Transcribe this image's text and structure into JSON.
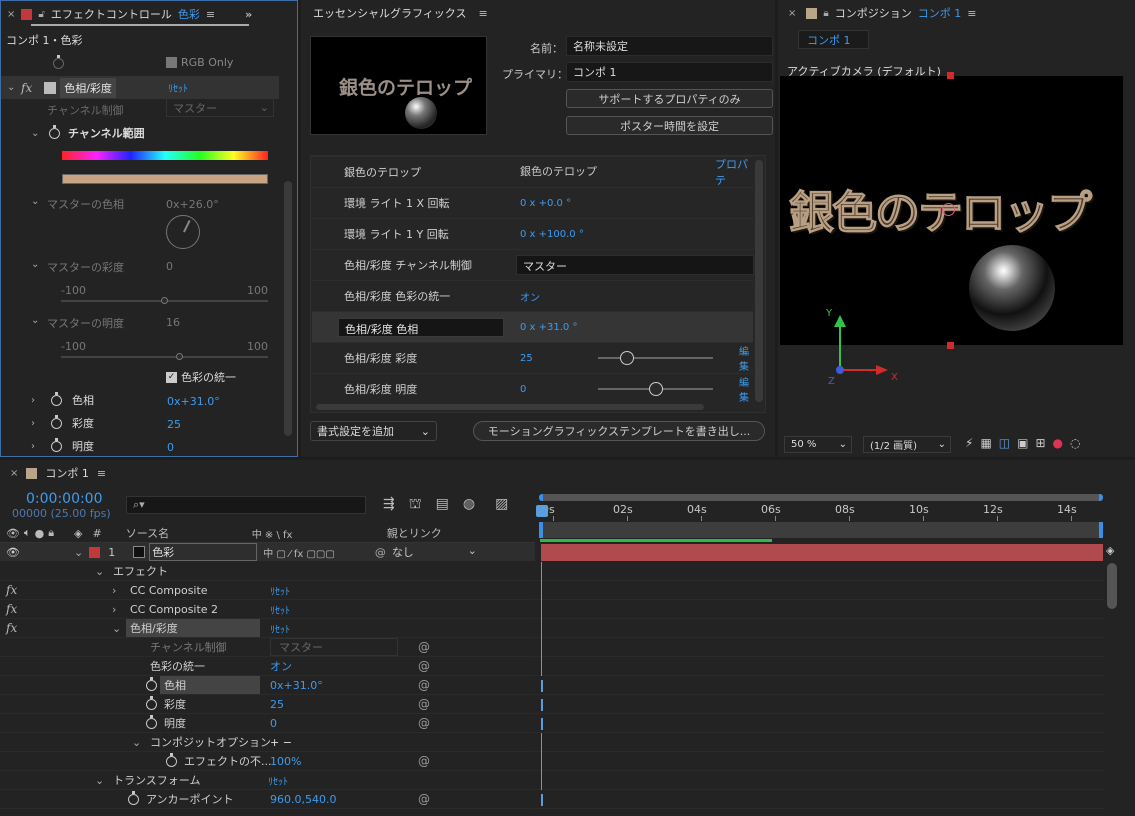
{
  "effect_controls": {
    "title": "エフェクトコントロール",
    "layer": "色彩",
    "breadcrumb": "コンポ 1・色彩",
    "rgb_only": "RGB Only",
    "effect_name": "色相/彩度",
    "reset": "ﾘｾｯﾄ",
    "channel_control_label": "チャンネル制御",
    "channel_control_value": "マスター",
    "channel_range": "チャンネル範囲",
    "master_hue_label": "マスターの色相",
    "master_hue_value": "0x+26.0°",
    "master_sat_label": "マスターの彩度",
    "master_sat_value": "0",
    "slider_min": "-100",
    "slider_max": "100",
    "master_light_label": "マスターの明度",
    "master_light_value": "16",
    "colorize": "色彩の統一",
    "hue_label": "色相",
    "hue_value": "0x+31.0°",
    "sat_label": "彩度",
    "sat_value": "25",
    "light_label": "明度",
    "light_value": "0"
  },
  "essential_graphics": {
    "title": "エッセンシャルグラフィックス",
    "preview_text": "銀色のテロップ",
    "name_label": "名前：",
    "name_value": "名称未設定",
    "primary_label": "プライマリ：",
    "primary_value": "コンポ 1",
    "btn_supported": "サポートするプロパティのみ",
    "btn_poster": "ポスター時間を設定",
    "rows": [
      {
        "label": "銀色のテロップ",
        "value": "銀色のテロップ",
        "extra": "プロパテ"
      },
      {
        "label": "環境 ライト 1 X 回転",
        "value": "0 x +0.0 °"
      },
      {
        "label": "環境 ライト 1 Y 回転",
        "value": "0 x +100.0 °"
      },
      {
        "label": "色相/彩度 チャンネル制御",
        "value": "マスター"
      },
      {
        "label": "色相/彩度 色彩の統一",
        "value": "オン"
      },
      {
        "label": "色相/彩度 色相",
        "value": "0 x +31.0 °"
      },
      {
        "label": "色相/彩度 彩度",
        "value": "25",
        "extra": "編集"
      },
      {
        "label": "色相/彩度 明度",
        "value": "0",
        "extra": "編集"
      }
    ],
    "add_format": "書式設定を追加",
    "export_btn": "モーショングラフィックステンプレートを書き出し..."
  },
  "composition": {
    "title": "コンポジション",
    "comp_name": "コンポ 1",
    "tab": "コンポ 1",
    "camera": "アクティブカメラ (デフォルト)",
    "text": "銀色のテロップ",
    "zoom": "50 %",
    "quality": "(1/2 画質)",
    "axis_y": "Y",
    "axis_x": "X",
    "axis_z": "Z"
  },
  "timeline": {
    "title": "コンポ 1",
    "timecode": "0:00:00:00",
    "frames": "00000 (25.00 fps)",
    "search_placeholder": "",
    "col_source": "ソース名",
    "col_switches": "中 ※ \\ fx",
    "col_parent": "親とリンク",
    "col_num": "#",
    "layer_num": "1",
    "layer_name": "色彩",
    "parent_value": "なし",
    "ruler": [
      "0s",
      "02s",
      "04s",
      "06s",
      "08s",
      "10s",
      "12s",
      "14s"
    ],
    "effects_label": "エフェクト",
    "cc_composite": "CC Composite",
    "cc_composite2": "CC Composite 2",
    "hue_sat": "色相/彩度",
    "reset": "ﾘｾｯﾄ",
    "channel_control": "チャンネル制御",
    "channel_value": "マスター",
    "colorize": "色彩の統一",
    "colorize_value": "オン",
    "hue": "色相",
    "hue_value": "0x+31.0°",
    "sat": "彩度",
    "sat_value": "25",
    "light": "明度",
    "light_value": "0",
    "composite_options": "コンポジットオプション",
    "composite_plusminus": "+ −",
    "effect_opacity": "エフェクトの不...",
    "effect_opacity_value": "100%",
    "transform": "トランスフォーム",
    "anchor": "アンカーポイント",
    "anchor_value": "960.0,540.0"
  },
  "colors": {
    "accent": "#3d9cf0",
    "layer_bar": "#b04a4f",
    "label_red": "#c4373a",
    "work_area": "#2fb84a"
  }
}
